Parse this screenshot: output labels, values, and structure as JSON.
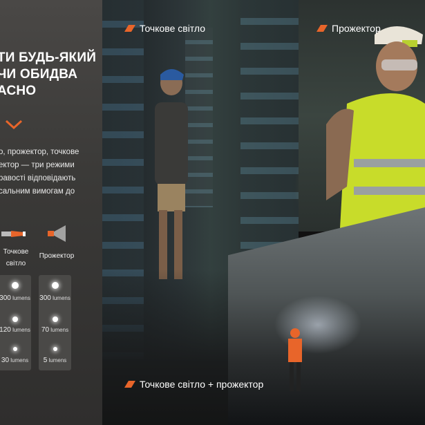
{
  "headline": "ТИ БУДЬ-ЯКИЙ\n ЧИ ОБИДВА\nАСНО",
  "description": "о, прожектор, точкове\nектор — три режими\nравості відповідають\nсальним вимогам до",
  "modes": [
    {
      "label": "Точкове\nсвітло",
      "levels": [
        {
          "value": "300",
          "unit": "lumens"
        },
        {
          "value": "120",
          "unit": "lumens"
        },
        {
          "value": "30",
          "unit": "lumens"
        }
      ]
    },
    {
      "label": "Прожектор",
      "levels": [
        {
          "value": "300",
          "unit": "lumens"
        },
        {
          "value": "70",
          "unit": "lumens"
        },
        {
          "value": "5",
          "unit": "lumens"
        }
      ]
    }
  ],
  "tags": {
    "spot": "Точкове світло",
    "flood": "Прожектор",
    "both": "Точкове світло + прожектор"
  },
  "colors": {
    "accent": "#e8652a",
    "vest": "#c8dc2a"
  }
}
